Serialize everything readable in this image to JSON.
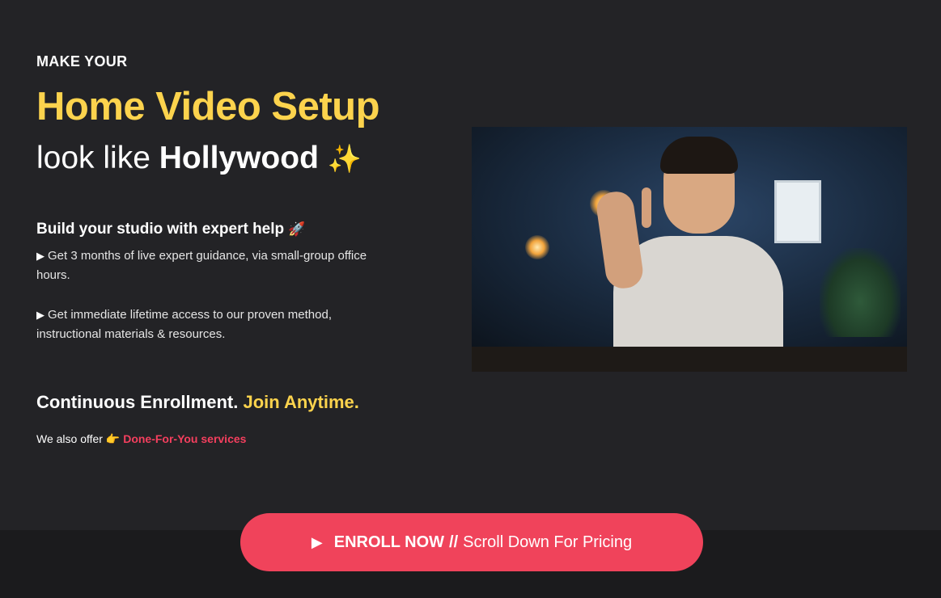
{
  "hero": {
    "kicker": "MAKE YOUR",
    "headline": "Home Video Setup",
    "subline_prefix": "look like",
    "subline_strong": "Hollywood",
    "subline_emoji": "✨"
  },
  "features": {
    "title": "Build your studio with expert help",
    "title_emoji": "🚀",
    "bullet_glyph": "▶",
    "items": [
      "Get 3 months of live expert guidance, via small-group office hours.",
      "Get immediate lifetime access to our proven method, instructional materials & resources."
    ]
  },
  "enrollment": {
    "text": "Continuous Enrollment.",
    "accent": "Join Anytime."
  },
  "offer": {
    "prefix": "We also offer",
    "emoji": "👉",
    "link_label": "Done-For-You services"
  },
  "cta": {
    "play_glyph": "▶",
    "strong_label": "ENROLL NOW",
    "separator": "//",
    "label": "Scroll Down For Pricing"
  },
  "colors": {
    "background": "#232326",
    "accent_yellow": "#fcd34d",
    "accent_red": "#f0435b"
  },
  "icons": {
    "video": "video-thumbnail",
    "sparkles": "sparkles-icon",
    "rocket": "rocket-icon",
    "pointing_hand": "pointing-right-icon",
    "play": "play-icon"
  }
}
